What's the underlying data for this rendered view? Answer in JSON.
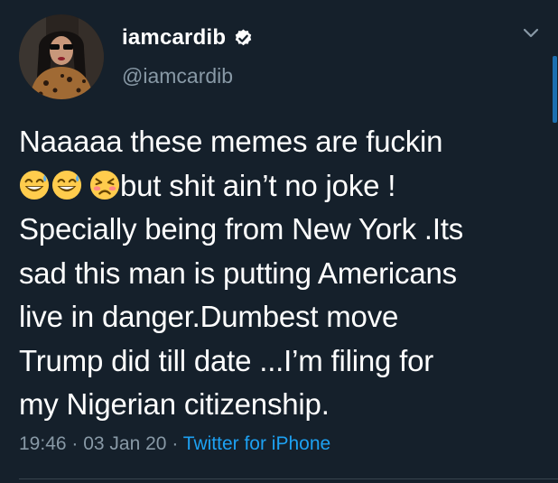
{
  "colors": {
    "background": "#15202b",
    "text": "#ffffff",
    "secondary_text": "#8899a6",
    "accent": "#1da1f2",
    "divider": "#38444d"
  },
  "author": {
    "display_name": "iamcardib",
    "handle": "@iamcardib",
    "verified": true,
    "avatar_icon": "profile-photo",
    "verified_icon": "verified-badge-icon"
  },
  "menu": {
    "icon": "chevron-down-icon"
  },
  "tweet": {
    "lines": [
      "Naaaaa these memes are fuckin",
      "but shit ain’t no joke !",
      "Specially being from New York .Its",
      "sad this man is putting Americans",
      "live in danger.Dumbest move",
      "Trump did till date ...I’m filing for",
      "my Nigerian citizenship."
    ],
    "emojis": [
      "grinning-sweat-emoji",
      "grinning-sweat-emoji",
      "persevering-face-emoji"
    ]
  },
  "meta": {
    "time": "19:46",
    "separator": " · ",
    "date": "03 Jan 20",
    "source": "Twitter for iPhone"
  }
}
